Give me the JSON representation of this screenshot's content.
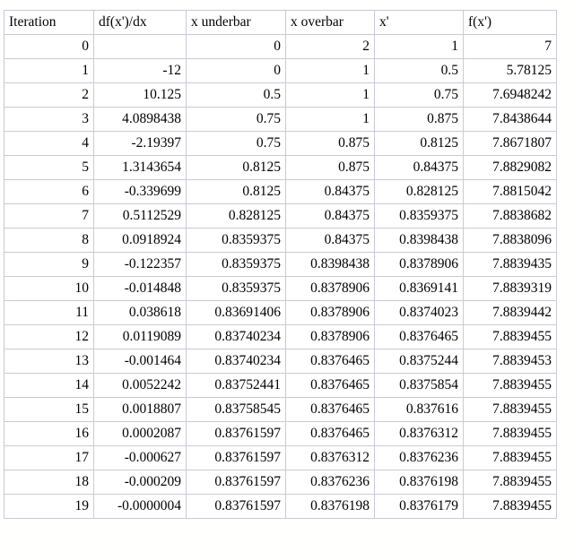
{
  "table": {
    "headers": [
      "Iteration",
      "df(x')/dx",
      "x underbar",
      "x overbar",
      "x'",
      "f(x')"
    ],
    "rows": [
      [
        "0",
        "",
        "0",
        "2",
        "1",
        "7"
      ],
      [
        "1",
        "-12",
        "0",
        "1",
        "0.5",
        "5.78125"
      ],
      [
        "2",
        "10.125",
        "0.5",
        "1",
        "0.75",
        "7.6948242"
      ],
      [
        "3",
        "4.0898438",
        "0.75",
        "1",
        "0.875",
        "7.8438644"
      ],
      [
        "4",
        "-2.19397",
        "0.75",
        "0.875",
        "0.8125",
        "7.8671807"
      ],
      [
        "5",
        "1.3143654",
        "0.8125",
        "0.875",
        "0.84375",
        "7.8829082"
      ],
      [
        "6",
        "-0.339699",
        "0.8125",
        "0.84375",
        "0.828125",
        "7.8815042"
      ],
      [
        "7",
        "0.5112529",
        "0.828125",
        "0.84375",
        "0.8359375",
        "7.8838682"
      ],
      [
        "8",
        "0.0918924",
        "0.8359375",
        "0.84375",
        "0.8398438",
        "7.8838096"
      ],
      [
        "9",
        "-0.122357",
        "0.8359375",
        "0.8398438",
        "0.8378906",
        "7.8839435"
      ],
      [
        "10",
        "-0.014848",
        "0.8359375",
        "0.8378906",
        "0.8369141",
        "7.8839319"
      ],
      [
        "11",
        "0.038618",
        "0.83691406",
        "0.8378906",
        "0.8374023",
        "7.8839442"
      ],
      [
        "12",
        "0.0119089",
        "0.83740234",
        "0.8378906",
        "0.8376465",
        "7.8839455"
      ],
      [
        "13",
        "-0.001464",
        "0.83740234",
        "0.8376465",
        "0.8375244",
        "7.8839453"
      ],
      [
        "14",
        "0.0052242",
        "0.83752441",
        "0.8376465",
        "0.8375854",
        "7.8839455"
      ],
      [
        "15",
        "0.0018807",
        "0.83758545",
        "0.8376465",
        "0.837616",
        "7.8839455"
      ],
      [
        "16",
        "0.0002087",
        "0.83761597",
        "0.8376465",
        "0.8376312",
        "7.8839455"
      ],
      [
        "17",
        "-0.000627",
        "0.83761597",
        "0.8376312",
        "0.8376236",
        "7.8839455"
      ],
      [
        "18",
        "-0.000209",
        "0.83761597",
        "0.8376236",
        "0.8376198",
        "7.8839455"
      ],
      [
        "19",
        "-0.0000004",
        "0.83761597",
        "0.8376198",
        "0.8376179",
        "7.8839455"
      ]
    ]
  },
  "colors": {
    "border": "#c9c9dd",
    "background": "#fffffd",
    "cell_background": "#ffffff",
    "text": "#000000"
  }
}
